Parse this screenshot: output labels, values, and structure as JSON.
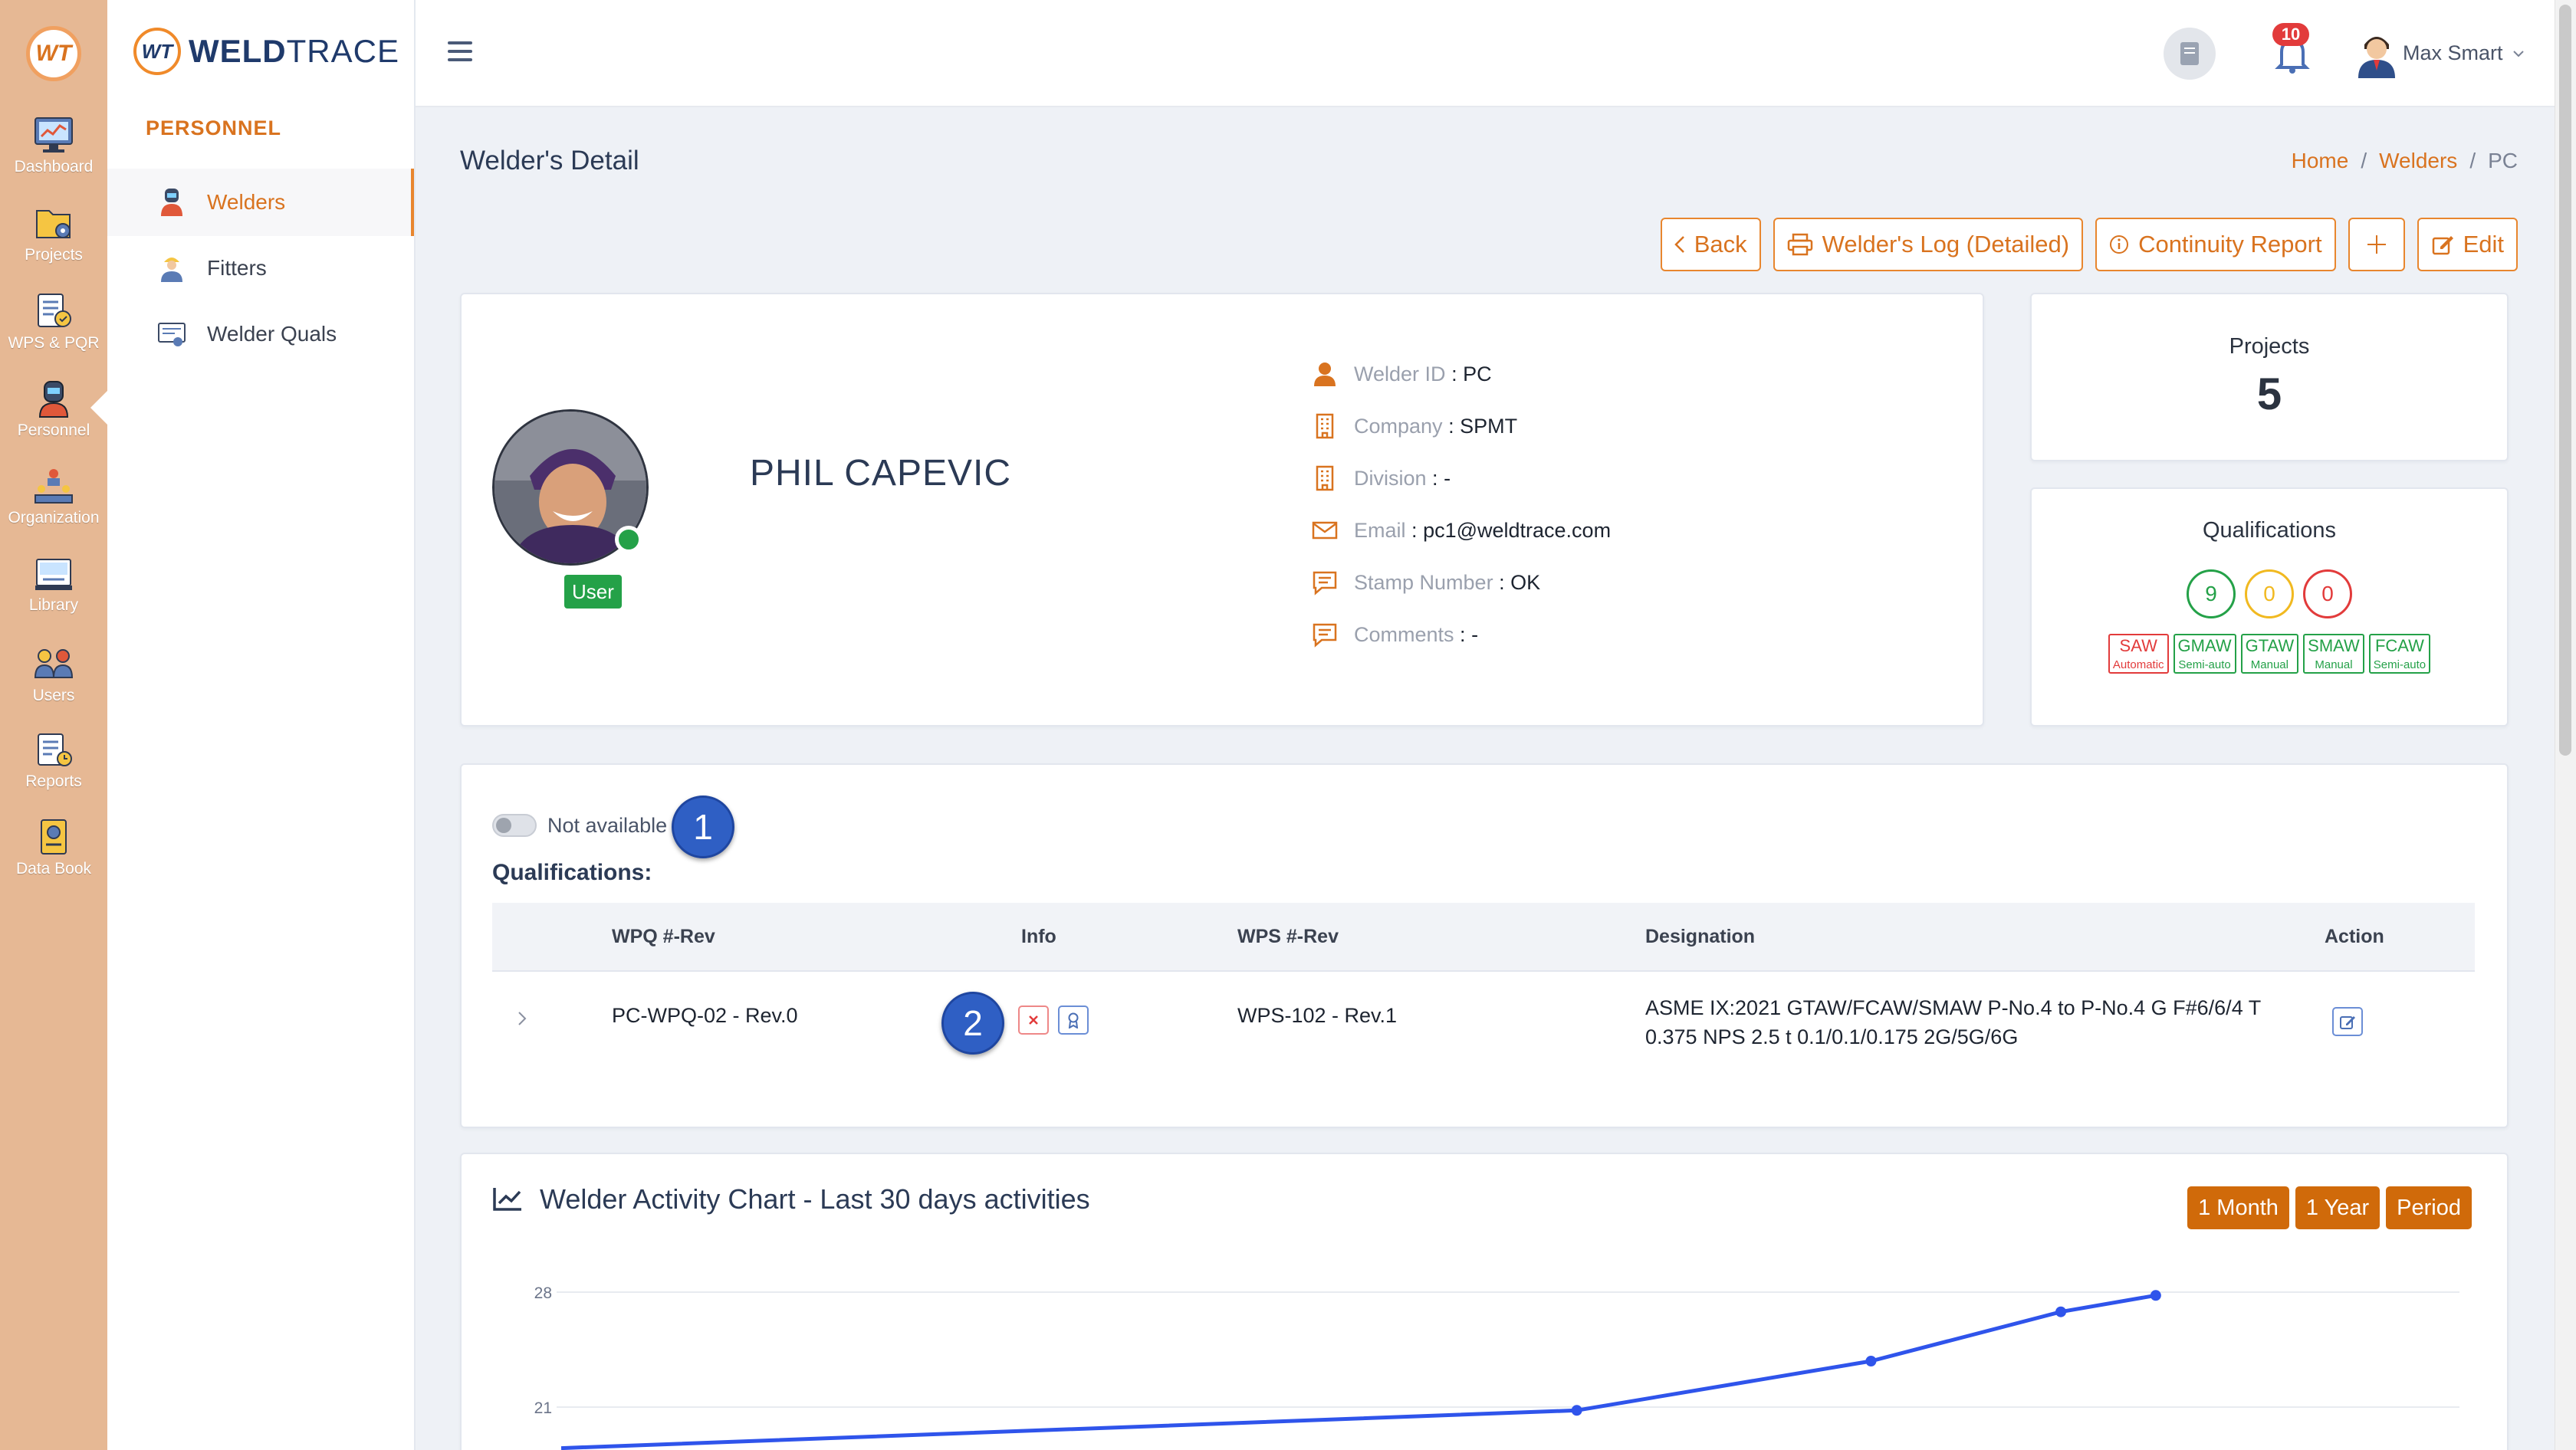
{
  "rail": {
    "items": [
      {
        "label": "Dashboard",
        "icon": "dashboard-icon"
      },
      {
        "label": "Projects",
        "icon": "projects-icon"
      },
      {
        "label": "WPS & PQR",
        "icon": "wps-pqr-icon"
      },
      {
        "label": "Personnel",
        "icon": "personnel-icon"
      },
      {
        "label": "Organization",
        "icon": "organization-icon"
      },
      {
        "label": "Library",
        "icon": "library-icon"
      },
      {
        "label": "Users",
        "icon": "users-icon"
      },
      {
        "label": "Reports",
        "icon": "reports-icon"
      },
      {
        "label": "Data Book",
        "icon": "data-book-icon"
      }
    ]
  },
  "brand": {
    "bold": "WELD",
    "rest": "TRACE",
    "badge": "WT"
  },
  "subnav": {
    "heading": "PERSONNEL",
    "items": [
      {
        "label": "Welders",
        "active": true
      },
      {
        "label": "Fitters",
        "active": false
      },
      {
        "label": "Welder Quals",
        "active": false
      }
    ]
  },
  "topbar": {
    "notification_count": "10",
    "user_name": "Max Smart"
  },
  "page": {
    "title": "Welder's Detail",
    "breadcrumb": {
      "home": "Home",
      "welders": "Welders",
      "current": "PC"
    }
  },
  "actions": {
    "back": "Back",
    "welder_log": "Welder's Log (Detailed)",
    "continuity": "Continuity Report",
    "edit": "Edit"
  },
  "profile": {
    "name": "PHIL CAPEVIC",
    "role": "User",
    "fields": [
      {
        "label": "Welder ID",
        "value": "PC",
        "icon": "user-icon"
      },
      {
        "label": "Company",
        "value": "SPMT",
        "icon": "building-icon"
      },
      {
        "label": "Division",
        "value": "-",
        "icon": "building-icon"
      },
      {
        "label": "Email",
        "value": "pc1@weldtrace.com",
        "icon": "mail-icon"
      },
      {
        "label": "Stamp Number",
        "value": "OK",
        "icon": "comment-icon"
      },
      {
        "label": "Comments",
        "value": "-",
        "icon": "comment-icon"
      }
    ]
  },
  "projects": {
    "label": "Projects",
    "value": "5"
  },
  "qualifications_summary": {
    "label": "Qualifications",
    "counts": {
      "active": "9",
      "expiring": "0",
      "expired": "0"
    },
    "processes": [
      {
        "name": "SAW",
        "sub": "Automatic",
        "status": "red"
      },
      {
        "name": "GMAW",
        "sub": "Semi-auto",
        "status": "green"
      },
      {
        "name": "GTAW",
        "sub": "Manual",
        "status": "green"
      },
      {
        "name": "SMAW",
        "sub": "Manual",
        "status": "green"
      },
      {
        "name": "FCAW",
        "sub": "Semi-auto",
        "status": "green"
      }
    ]
  },
  "qual_table": {
    "toggle_label": "Not available",
    "heading": "Qualifications:",
    "columns": {
      "wpq": "WPQ #-Rev",
      "info": "Info",
      "wps": "WPS #-Rev",
      "designation": "Designation",
      "action": "Action"
    },
    "rows": [
      {
        "wpq": "PC-WPQ-02 - Rev.0",
        "wps": "WPS-102 - Rev.1",
        "designation_line1": "ASME IX:2021 GTAW/FCAW/SMAW P-No.4 to P-No.4 G F#6/6/4 T",
        "designation_line2": "0.375 NPS 2.5 t 0.1/0.1/0.175 2G/5G/6G"
      }
    ],
    "markers": [
      "1",
      "2"
    ]
  },
  "activity": {
    "title": "Welder Activity Chart - Last 30 days activities",
    "buttons": [
      "1 Month",
      "1 Year",
      "Period"
    ]
  },
  "colors": {
    "accent": "#d9731f",
    "rail": "#e6b894",
    "green": "#24a148",
    "red": "#e23b3b",
    "blue_marker": "#2f5fc4",
    "line": "#2f54eb"
  },
  "chart_data": {
    "type": "line",
    "title": "",
    "xlabel": "",
    "ylabel": "",
    "y_ticks": [
      21,
      28
    ],
    "ylim": [
      14,
      28.5
    ],
    "xlim": [
      0,
      10
    ],
    "series": [
      {
        "x": [
          0,
          5.35,
          6.9,
          7.9,
          8.4
        ],
        "y": [
          18.5,
          20.8,
          23.8,
          26.8,
          27.8
        ]
      }
    ],
    "grid": true
  }
}
